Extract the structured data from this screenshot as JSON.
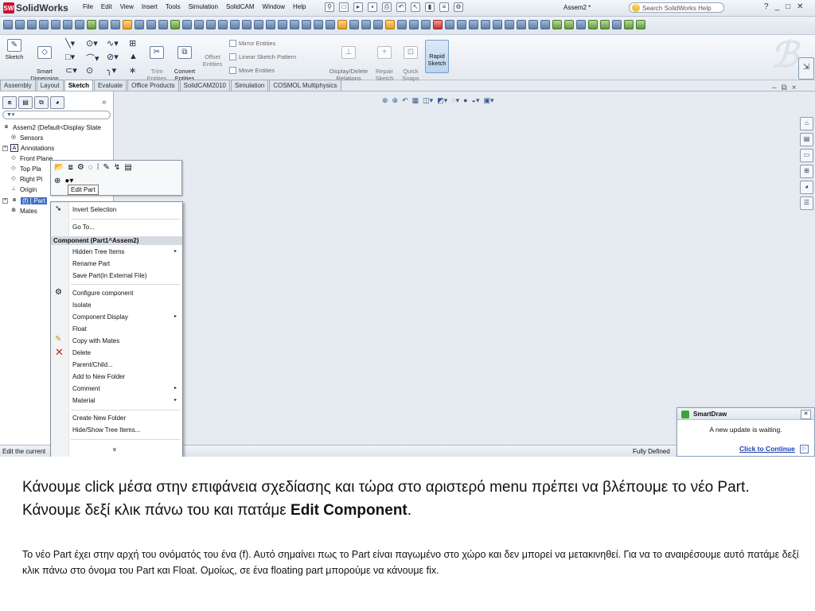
{
  "app": {
    "name": "SolidWorks",
    "logo_mark": "SW",
    "menu": [
      "File",
      "Edit",
      "View",
      "Insert",
      "Tools",
      "Simulation",
      "SolidCAM",
      "Window",
      "Help"
    ],
    "document_title": "Assem2 *",
    "search_placeholder": "Search SolidWorks Help",
    "window_controls": [
      "?",
      "_",
      "□",
      "✕"
    ]
  },
  "ribbon": {
    "sketch": "Sketch",
    "smart_dimension": "Smart\nDimension",
    "trim_entities": "Trim\nEntities",
    "convert_entities": "Convert\nEntities",
    "offset_entities": "Offset\nEntities",
    "mirror_entities": "Mirror Entities",
    "linear_sketch_pattern": "Linear Sketch Pattern",
    "move_entities": "Move Entities",
    "display_delete_relations": "Display/Delete\nRelations",
    "repair_sketch": "Repair\nSketch",
    "quick_snaps": "Quick\nSnaps",
    "rapid_sketch": "Rapid\nSketch"
  },
  "tabs": [
    "Assembly",
    "Layout",
    "Sketch",
    "Evaluate",
    "Office Products",
    "SolidCAM2010",
    "Simulation",
    "COSMOL Multiphysics"
  ],
  "active_tab": "Sketch",
  "tree": {
    "root": "Assem2  (Default<Display State",
    "sensors": "Sensors",
    "annotations": "Annotations",
    "front_plane": "Front Plane",
    "top_plane": "Top Pla",
    "right_plane": "Right Pl",
    "origin": "Origin",
    "part": "(f) [ Part",
    "mates": "Mates"
  },
  "mini_toolbar": {
    "tooltip": "Edit Part"
  },
  "context_menu": {
    "invert_selection": "Invert Selection",
    "go_to": "Go To...",
    "header": "Component (Part1^Assem2)",
    "items": [
      "Hidden Tree Items",
      "Rename Part",
      "Save Part(in External File)",
      "Configure component",
      "Isolate",
      "Component Display",
      "Float",
      "Copy with Mates",
      "Delete",
      "Parent/Child...",
      "Add to New Folder",
      "Comment",
      "Material",
      "Create New Folder",
      "Hide/Show Tree Items..."
    ],
    "more": "»"
  },
  "status": {
    "left": "Edit the current",
    "right": "Fully Defined"
  },
  "smartdraw": {
    "title": "SmartDraw",
    "message": "A new update is waiting.",
    "link": "Click to Continue"
  },
  "slide": {
    "caption_main": "Κάνουμε click μέσα στην επιφάνεια σχεδίασης και τώρα στο αριστερό menu πρέπει να βλέπουμε το νέο Part. Κάνουμε δεξί κλικ πάνω του και πατάμε ",
    "caption_bold": "Edit Component",
    "caption_end": ".",
    "note": "Το νέο Part έχει στην αρχή του ονόματός του ένα (f). Αυτό σημαίνει πως το Part είναι παγωμένο στο χώρο και δεν μπορεί να μετακινηθεί. Για να το αναιρέσουμε αυτό πατάμε δεξί κλικ πάνω στο όνομα του Part και Float. Ομοίως, σε ένα floating part μπορούμε να κάνουμε fix."
  }
}
